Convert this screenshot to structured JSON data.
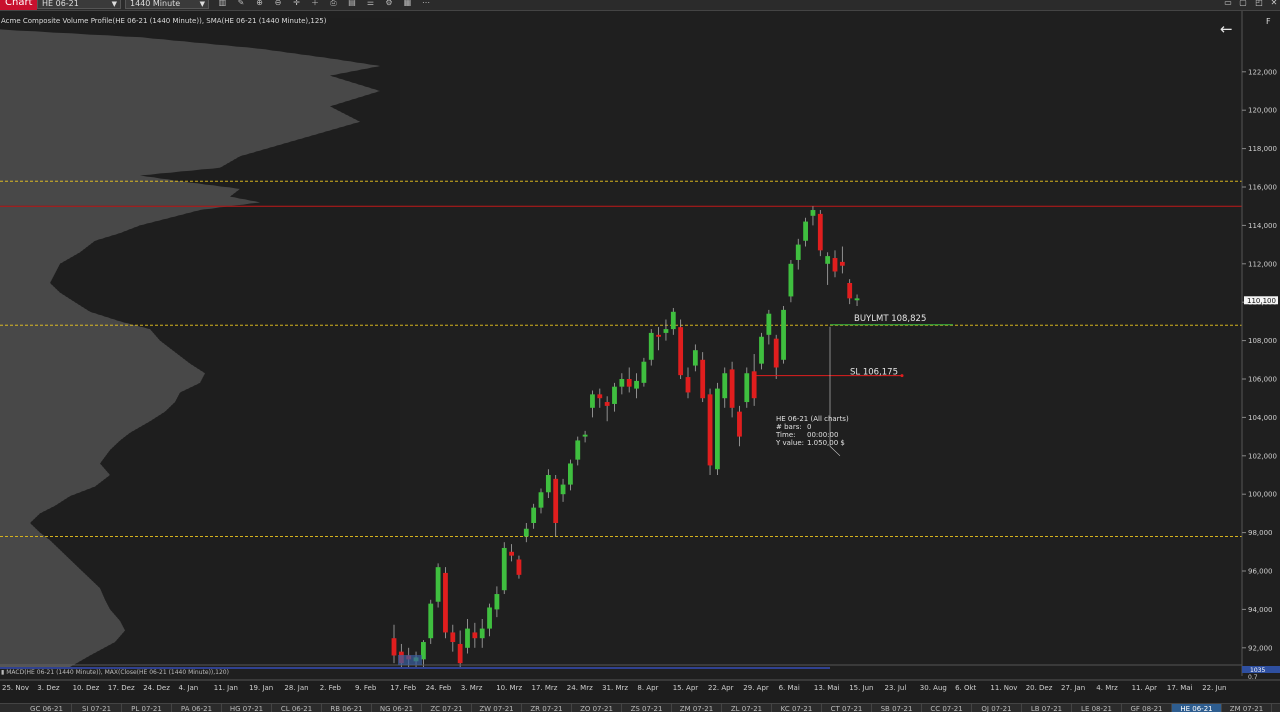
{
  "toolbar": {
    "chart_label": "Chart",
    "instrument": "HE 06-21",
    "interval": "1440 Minute",
    "icons": [
      "bars-icon",
      "draw-icon",
      "zoom-in-icon",
      "zoom-out-icon",
      "crosshair-icon",
      "add-icon",
      "save-icon",
      "data-box-icon",
      "properties-icon",
      "strategy-icon",
      "layout-icon",
      "more-icon"
    ]
  },
  "indicator_label": "Acme Composite Volume Profile(HE 06-21 (1440 Minute)), SMA(HE 06-21 (1440 Minute),125)",
  "f_label": "F",
  "bottom_indicator_text": "▮ MACD(HE 06-21 (1440 Minute)), MAX(Close(HE 06-21 (1440 Minute)),120)",
  "bottom_right_values": [
    "1035",
    "0.7"
  ],
  "price_axis": {
    "labels": [
      "122,000",
      "120,000",
      "118,000",
      "116,000",
      "114,000",
      "112,000",
      "110,000",
      "108,000",
      "106,000",
      "104,000",
      "102,000",
      "100,000",
      "98,000",
      "96,000",
      "94,000",
      "92,000"
    ],
    "current_price": "110,100"
  },
  "time_axis": {
    "labels": [
      "25. Nov",
      "3. Dez",
      "10. Dez",
      "17. Dez",
      "24. Dez",
      "4. Jan",
      "11. Jan",
      "19. Jan",
      "28. Jan",
      "2. Feb",
      "9. Feb",
      "17. Feb",
      "24. Feb",
      "3. Mrz",
      "10. Mrz",
      "17. Mrz",
      "24. Mrz",
      "31. Mrz",
      "8. Apr",
      "15. Apr",
      "22. Apr",
      "29. Apr",
      "6. Mai",
      "13. Mai",
      "15. Jun",
      "23. Jul",
      "30. Aug",
      "6. Okt",
      "11. Nov",
      "20. Dez",
      "27. Jan",
      "4. Mrz",
      "11. Apr",
      "17. Mai",
      "22. Jun"
    ]
  },
  "orders": {
    "buy_label": "BUYLMT 108,825",
    "buy_price": 108.825,
    "sl_label": "SL 106,175",
    "sl_price": 106.175
  },
  "data_box": {
    "title": "HE 06-21 (All charts)",
    "rows": [
      {
        "k": "# bars:",
        "v": "0"
      },
      {
        "k": "Time:",
        "v": "00:00:00"
      },
      {
        "k": "Y value:",
        "v": "1.050,00 $"
      }
    ]
  },
  "levels": [
    {
      "price": 116.3,
      "color": "#d4b21f",
      "style": "dashed"
    },
    {
      "price": 115.0,
      "color": "#c01818",
      "style": "solid"
    },
    {
      "price": 108.8,
      "color": "#d4b21f",
      "style": "dashed"
    },
    {
      "price": 97.8,
      "color": "#d4b21f",
      "style": "dashed"
    }
  ],
  "chart_data": {
    "type": "candlestick",
    "y_range": [
      91.0,
      124.0
    ],
    "candles": [
      [
        92.5,
        93.2,
        91.2,
        91.6
      ],
      [
        91.8,
        92.2,
        91.0,
        91.2
      ],
      [
        91.6,
        92.0,
        91.0,
        91.4
      ],
      [
        91.3,
        91.8,
        91.0,
        91.5
      ],
      [
        91.4,
        92.4,
        91.0,
        92.3
      ],
      [
        92.5,
        94.5,
        92.2,
        94.3
      ],
      [
        94.4,
        96.4,
        94.1,
        96.2
      ],
      [
        95.9,
        96.2,
        92.5,
        92.8
      ],
      [
        92.8,
        93.2,
        91.8,
        92.3
      ],
      [
        92.2,
        92.9,
        91.0,
        91.2
      ],
      [
        92.0,
        93.5,
        91.7,
        93.0
      ],
      [
        92.8,
        93.3,
        92.0,
        92.5
      ],
      [
        92.5,
        93.5,
        92.0,
        93.0
      ],
      [
        93.0,
        94.3,
        92.6,
        94.1
      ],
      [
        94.0,
        95.2,
        93.6,
        94.8
      ],
      [
        95.0,
        97.5,
        94.8,
        97.2
      ],
      [
        97.0,
        97.4,
        96.5,
        96.8
      ],
      [
        96.6,
        96.8,
        95.6,
        95.8
      ],
      [
        97.8,
        98.5,
        97.5,
        98.2
      ],
      [
        98.5,
        99.5,
        98.2,
        99.3
      ],
      [
        99.3,
        100.3,
        99.0,
        100.1
      ],
      [
        100.1,
        101.3,
        99.8,
        101.0
      ],
      [
        100.8,
        101.0,
        97.8,
        98.5
      ],
      [
        100.0,
        100.8,
        99.6,
        100.5
      ],
      [
        100.5,
        101.8,
        100.2,
        101.6
      ],
      [
        101.8,
        103.0,
        101.5,
        102.8
      ],
      [
        103.0,
        103.3,
        102.7,
        103.1
      ],
      [
        104.5,
        105.4,
        104.0,
        105.2
      ],
      [
        105.2,
        105.5,
        104.5,
        105.0
      ],
      [
        104.8,
        105.1,
        103.8,
        104.6
      ],
      [
        104.7,
        105.8,
        104.3,
        105.6
      ],
      [
        105.6,
        106.3,
        105.2,
        106.0
      ],
      [
        106.0,
        106.6,
        105.3,
        105.6
      ],
      [
        105.5,
        106.3,
        105.0,
        105.9
      ],
      [
        105.8,
        107.1,
        105.6,
        106.9
      ],
      [
        107.0,
        108.6,
        106.7,
        108.4
      ],
      [
        108.3,
        108.7,
        107.5,
        108.2
      ],
      [
        108.4,
        109.1,
        108.0,
        108.6
      ],
      [
        108.6,
        109.7,
        108.3,
        109.5
      ],
      [
        108.7,
        109.1,
        106.0,
        106.2
      ],
      [
        106.1,
        106.6,
        105.0,
        105.3
      ],
      [
        106.7,
        107.8,
        106.4,
        107.5
      ],
      [
        107.0,
        107.4,
        104.8,
        105.0
      ],
      [
        105.2,
        105.5,
        101.0,
        101.5
      ],
      [
        101.3,
        105.8,
        101.0,
        105.5
      ],
      [
        105.0,
        106.6,
        104.5,
        106.3
      ],
      [
        106.5,
        106.9,
        104.0,
        104.5
      ],
      [
        104.3,
        104.6,
        102.5,
        103.0
      ],
      [
        104.8,
        106.6,
        104.5,
        106.3
      ],
      [
        106.4,
        107.3,
        104.6,
        105.0
      ],
      [
        106.8,
        108.4,
        106.5,
        108.2
      ],
      [
        108.3,
        109.6,
        107.8,
        109.4
      ],
      [
        108.1,
        108.3,
        106.0,
        106.6
      ],
      [
        107.0,
        109.8,
        106.8,
        109.6
      ],
      [
        110.3,
        112.2,
        110.0,
        112.0
      ],
      [
        112.2,
        113.3,
        111.7,
        113.0
      ],
      [
        113.2,
        114.4,
        112.9,
        114.2
      ],
      [
        114.5,
        115.0,
        114.0,
        114.8
      ],
      [
        114.6,
        114.8,
        112.4,
        112.7
      ],
      [
        112.0,
        112.6,
        110.9,
        112.4
      ],
      [
        112.3,
        112.7,
        111.3,
        111.6
      ],
      [
        112.1,
        112.9,
        111.5,
        111.9
      ],
      [
        111.0,
        111.2,
        109.9,
        110.2
      ],
      [
        110.1,
        110.4,
        109.8,
        110.2
      ]
    ]
  }
}
